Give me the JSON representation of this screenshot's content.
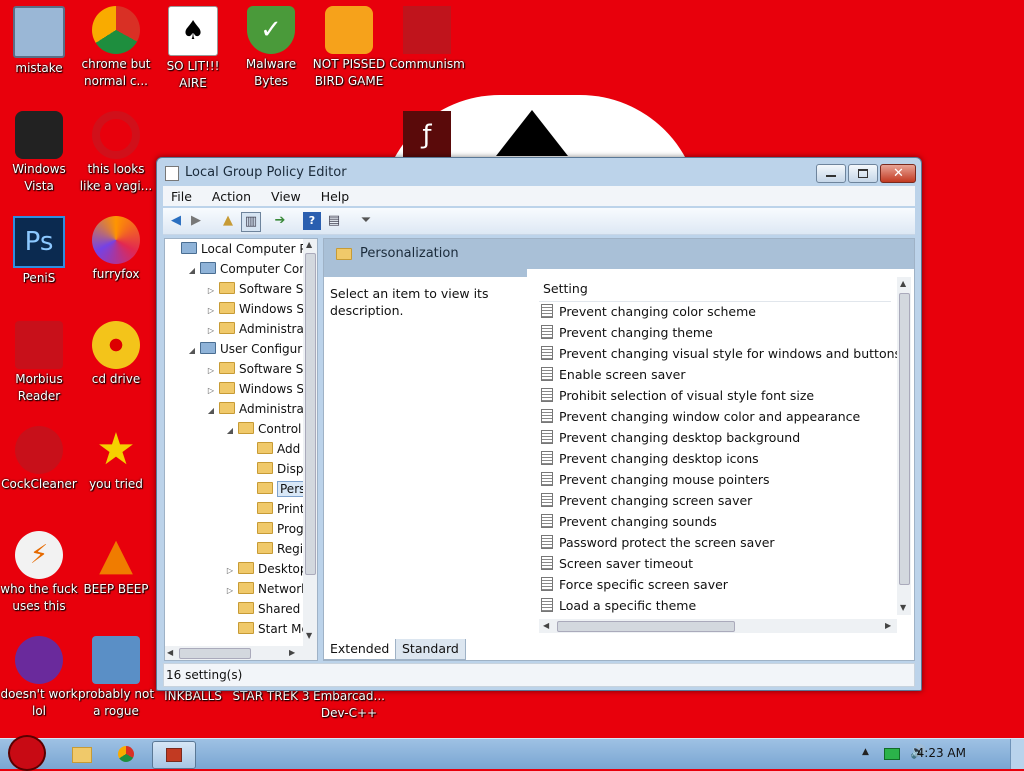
{
  "desktop": {
    "icons": [
      {
        "label": "mistake",
        "icon": "monitor-warning-icon"
      },
      {
        "label": "chrome but normal c...",
        "icon": "chrome-icon"
      },
      {
        "label": "SO LIT!!! AIRE",
        "icon": "spade-card-icon"
      },
      {
        "label": "Malware Bytes",
        "icon": "shield-check-icon"
      },
      {
        "label": "NOT PISSED BIRD GAME",
        "icon": "green-pig-icon"
      },
      {
        "label": "Communism",
        "icon": "red-flag-icon"
      },
      {
        "label": "Windows Vista",
        "icon": "trash-bin-icon"
      },
      {
        "label": "this looks like a vagi...",
        "icon": "opera-icon"
      },
      {
        "label": "INKBALLS",
        "icon": "flash-icon"
      },
      {
        "label": "STAR TREK 3",
        "icon": "red-bird-icon"
      },
      {
        "label": "Embarcad... Dev-C++",
        "icon": "red-bird-icon"
      },
      {
        "label": "",
        "icon": "flash-icon"
      },
      {
        "label": "PeniS",
        "icon": "photoshop-icon"
      },
      {
        "label": "furryfox",
        "icon": "firefox-icon"
      },
      {
        "label": "Morbius Reader",
        "icon": "acrobat-icon"
      },
      {
        "label": "cd drive",
        "icon": "cd-icon"
      },
      {
        "label": "CockCleaner",
        "icon": "ccleaner-icon"
      },
      {
        "label": "you tried",
        "icon": "gold-star-icon"
      },
      {
        "label": "who the fuck uses this",
        "icon": "lightning-icon"
      },
      {
        "label": "BEEP BEEP",
        "icon": "vlc-cone-icon"
      },
      {
        "label": "doesn't work lol",
        "icon": "yahoo-messenger-icon"
      },
      {
        "label": "probably not a rogue",
        "icon": "gear-monitor-icon"
      }
    ]
  },
  "window": {
    "title": "Local Group Policy Editor",
    "menu": [
      "File",
      "Action",
      "View",
      "Help"
    ],
    "tree": [
      {
        "label": "Local Computer Poli",
        "level": 0,
        "expander": "",
        "icon": "computer-policy-icon"
      },
      {
        "label": "Computer Config",
        "level": 1,
        "expander": "◢",
        "icon": "computer-icon"
      },
      {
        "label": "Software Sett",
        "level": 2,
        "expander": "▷",
        "icon": "folder-icon"
      },
      {
        "label": "Windows Set",
        "level": 2,
        "expander": "▷",
        "icon": "folder-icon"
      },
      {
        "label": "Administrative",
        "level": 2,
        "expander": "▷",
        "icon": "folder-icon"
      },
      {
        "label": "User Configurati",
        "level": 1,
        "expander": "◢",
        "icon": "users-icon"
      },
      {
        "label": "Software Sett",
        "level": 2,
        "expander": "▷",
        "icon": "folder-icon"
      },
      {
        "label": "Windows Set",
        "level": 2,
        "expander": "▷",
        "icon": "folder-icon"
      },
      {
        "label": "Administrative",
        "level": 2,
        "expander": "◢",
        "icon": "folder-icon"
      },
      {
        "label": "Control Pa",
        "level": 3,
        "expander": "◢",
        "icon": "folder-icon"
      },
      {
        "label": "Add or",
        "level": 4,
        "expander": "",
        "icon": "folder-icon"
      },
      {
        "label": "Displa",
        "level": 4,
        "expander": "",
        "icon": "folder-icon"
      },
      {
        "label": "Person",
        "level": 4,
        "expander": "",
        "icon": "folder-icon",
        "selected": true
      },
      {
        "label": "Printer",
        "level": 4,
        "expander": "",
        "icon": "folder-icon"
      },
      {
        "label": "Progra",
        "level": 4,
        "expander": "",
        "icon": "folder-icon"
      },
      {
        "label": "Region",
        "level": 4,
        "expander": "",
        "icon": "folder-icon"
      },
      {
        "label": "Desktop",
        "level": 3,
        "expander": "▷",
        "icon": "folder-icon"
      },
      {
        "label": "Network",
        "level": 3,
        "expander": "▷",
        "icon": "folder-icon"
      },
      {
        "label": "Shared Fc",
        "level": 3,
        "expander": "",
        "icon": "folder-icon"
      },
      {
        "label": "Start Menu",
        "level": 3,
        "expander": "",
        "icon": "folder-icon"
      }
    ],
    "content": {
      "header": "Personalization",
      "description": "Select an item to view its description.",
      "column_header": "Setting",
      "settings": [
        "Prevent changing color scheme",
        "Prevent changing theme",
        "Prevent changing visual style for windows and buttons",
        "Enable screen saver",
        "Prohibit selection of visual style font size",
        "Prevent changing window color and appearance",
        "Prevent changing desktop background",
        "Prevent changing desktop icons",
        "Prevent changing mouse pointers",
        "Prevent changing screen saver",
        "Prevent changing sounds",
        "Password protect the screen saver",
        "Screen saver timeout",
        "Force specific screen saver",
        "Load a specific theme"
      ]
    },
    "tabs": [
      "Extended",
      "Standard"
    ],
    "status": "16 setting(s)"
  },
  "taskbar": {
    "time": "4:23 AM",
    "buttons": [
      "start-bird-icon",
      "explorer-folder-icon",
      "chrome-icon",
      "group-policy-icon"
    ]
  },
  "colors": {
    "wallpaper": "#e8000c",
    "window_frame": "#bcd3ea",
    "header_band": "#a9c0d7",
    "taskbar": "#8db4dc"
  }
}
